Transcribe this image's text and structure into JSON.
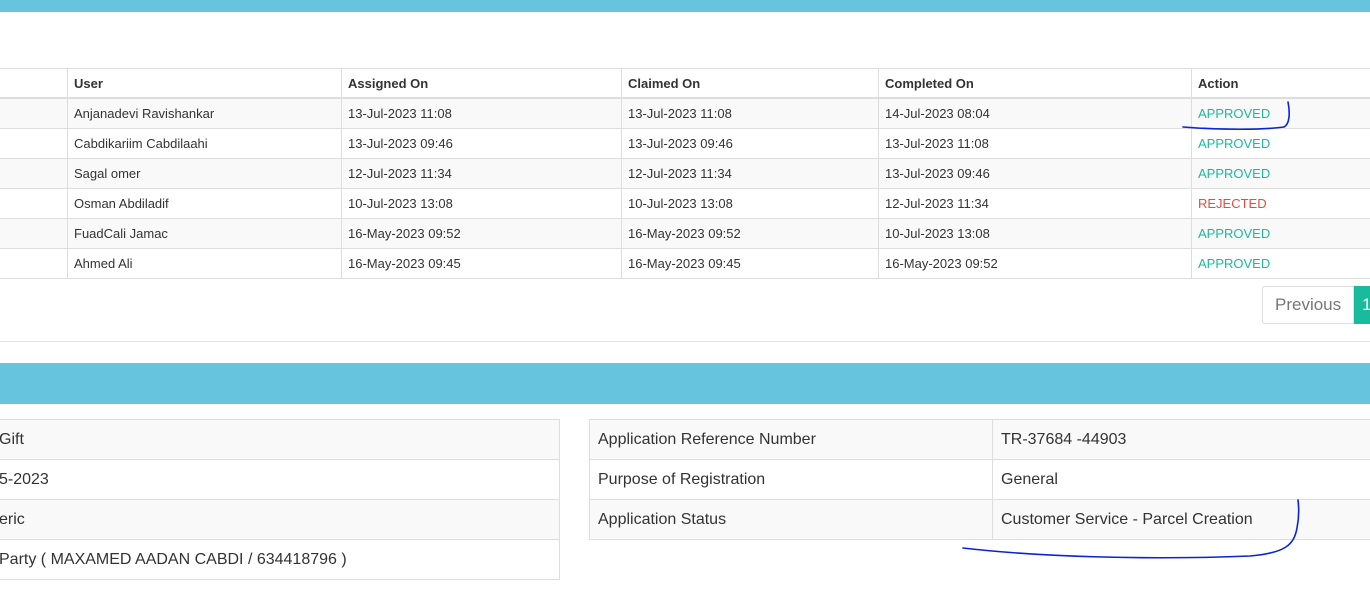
{
  "history": {
    "headers": [
      "",
      "User",
      "Assigned On",
      "Claimed On",
      "Completed On",
      "Action"
    ],
    "rows": [
      {
        "user": "Anjanadevi Ravishankar",
        "assigned": "13-Jul-2023 11:08",
        "claimed": "13-Jul-2023 11:08",
        "completed": "14-Jul-2023 08:04",
        "action": "APPROVED"
      },
      {
        "user": "Cabdikariim Cabdilaahi",
        "assigned": "13-Jul-2023 09:46",
        "claimed": "13-Jul-2023 09:46",
        "completed": "13-Jul-2023 11:08",
        "action": "APPROVED"
      },
      {
        "user": "Sagal omer",
        "assigned": "12-Jul-2023 11:34",
        "claimed": "12-Jul-2023 11:34",
        "completed": "13-Jul-2023 09:46",
        "action": "APPROVED"
      },
      {
        "user": "Osman Abdiladif",
        "assigned": "10-Jul-2023 13:08",
        "claimed": "10-Jul-2023 13:08",
        "completed": "12-Jul-2023 11:34",
        "action": "REJECTED"
      },
      {
        "user": "FuadCali Jamac",
        "assigned": "16-May-2023 09:52",
        "claimed": "16-May-2023 09:52",
        "completed": "10-Jul-2023 13:08",
        "action": "APPROVED"
      },
      {
        "user": "Ahmed Ali",
        "assigned": "16-May-2023 09:45",
        "claimed": "16-May-2023 09:45",
        "completed": "16-May-2023 09:52",
        "action": "APPROVED"
      }
    ]
  },
  "pagination": {
    "previous_label": "Previous",
    "current_page": "1"
  },
  "left_details": [
    "Gift",
    "5-2023",
    "eric",
    "Party ( MAXAMED AADAN CABDI / 634418796 )"
  ],
  "right_details": [
    {
      "label": "Application Reference Number",
      "value": "TR-37684 -44903"
    },
    {
      "label": "Purpose of Registration",
      "value": "General"
    },
    {
      "label": "Application Status",
      "value": "Customer Service - Parcel Creation"
    }
  ],
  "colors": {
    "band": "#67c4df",
    "approved": "#18bc9c",
    "rejected": "#e74c3c",
    "annotation_ink": "#0a22d8"
  }
}
